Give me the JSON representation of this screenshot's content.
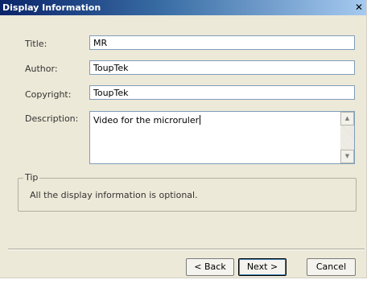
{
  "window": {
    "title": "Display Information",
    "close_glyph": "✕"
  },
  "form": {
    "title": {
      "label": "Title:",
      "value": "MR"
    },
    "author": {
      "label": "Author:",
      "value": "ToupTek"
    },
    "copyright": {
      "label": "Copyright:",
      "value": "ToupTek"
    },
    "description": {
      "label": "Description:",
      "value": "Video for the microruler"
    }
  },
  "tip": {
    "legend": "Tip",
    "text": "All the display information is optional."
  },
  "buttons": {
    "back": "< Back",
    "next": "Next >",
    "cancel": "Cancel"
  },
  "icons": {
    "scroll_up": "scroll-up-arrow-icon",
    "scroll_down": "scroll-down-arrow-icon",
    "close": "close-icon"
  },
  "colors": {
    "titlebar_start": "#0a246a",
    "titlebar_end": "#a6caf0",
    "dialog_bg": "#ece9d8",
    "field_border": "#7f9db9"
  }
}
